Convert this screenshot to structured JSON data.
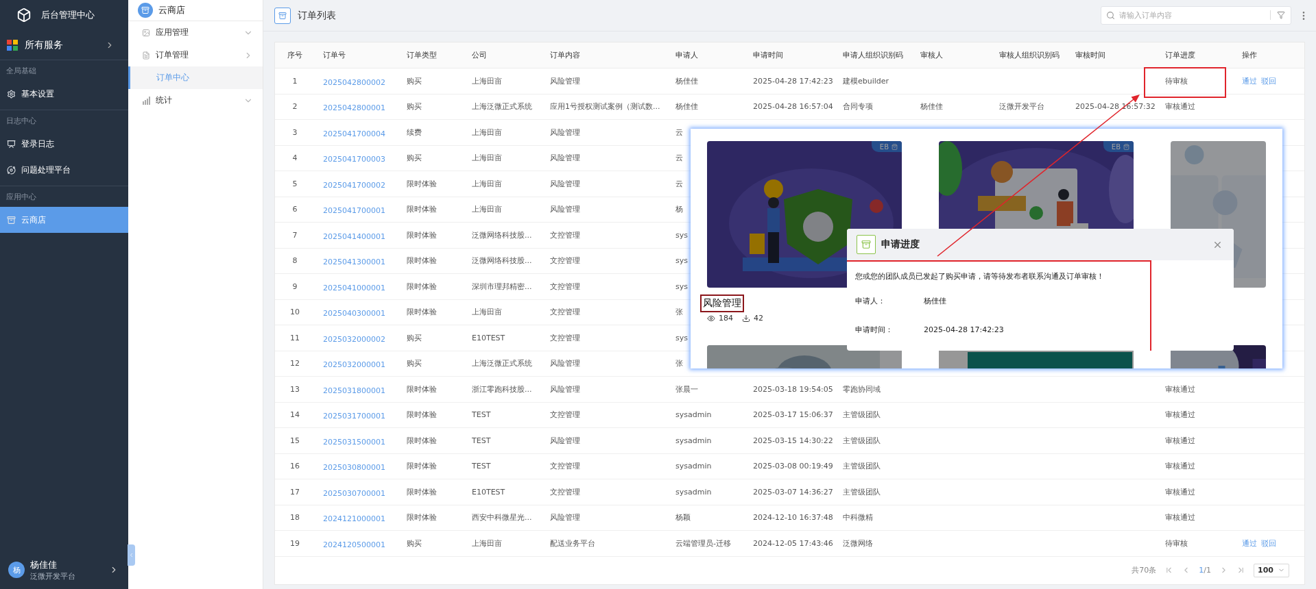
{
  "app": {
    "title": "后台管理中心",
    "all_services": "所有服务"
  },
  "sidebar": {
    "sections": [
      {
        "label": "全局基础",
        "items": [
          {
            "label": "基本设置",
            "selected": false
          }
        ]
      },
      {
        "label": "日志中心",
        "items": [
          {
            "label": "登录日志",
            "selected": false
          },
          {
            "label": "问题处理平台",
            "selected": false
          }
        ]
      },
      {
        "label": "应用中心",
        "items": [
          {
            "label": "云商店",
            "selected": true
          }
        ]
      }
    ],
    "user": {
      "avatar": "杨",
      "name": "杨佳佳",
      "org": "泛微开发平台"
    }
  },
  "subnav": {
    "title": "云商店",
    "items": [
      {
        "label": "应用管理",
        "expanded": false
      },
      {
        "label": "订单管理",
        "expanded": true,
        "children": [
          {
            "label": "订单中心",
            "selected": true
          }
        ]
      },
      {
        "label": "统计",
        "expanded": false
      }
    ]
  },
  "header": {
    "title": "订单列表",
    "search": {
      "placeholder": "请输入订单内容"
    }
  },
  "table": {
    "columns": [
      "序号",
      "订单号",
      "订单类型",
      "公司",
      "订单内容",
      "申请人",
      "申请时间",
      "申请人组织识别码",
      "审核人",
      "审核人组织识别码",
      "审核时间",
      "订单进度",
      "操作"
    ],
    "rows": [
      {
        "seq": "1",
        "order_no": "2025042800002",
        "type": "购买",
        "company": "上海田亩",
        "content": "风险管理",
        "applicant": "杨佳佳",
        "apply_time": "2025-04-28 17:42:23",
        "applicant_org": "建模ebuilder",
        "progress": "待审核",
        "actions": [
          "通过",
          "驳回"
        ],
        "marked": true
      },
      {
        "seq": "2",
        "order_no": "2025042800001",
        "type": "购买",
        "company": "上海泛微正式系统",
        "content": "应用1号授权测试案例（测试数...",
        "applicant": "杨佳佳",
        "apply_time": "2025-04-28 16:57:04",
        "applicant_org": "合同专项",
        "reviewer": "杨佳佳",
        "reviewer_org": "泛微开发平台",
        "review_time": "2025-04-28 16:57:32",
        "progress": "审核通过",
        "marked": false
      },
      {
        "seq": "3",
        "order_no": "2025041700004",
        "type": "续费",
        "company": "上海田亩",
        "content": "风险管理",
        "applicant": "云",
        "marked": false
      },
      {
        "seq": "4",
        "order_no": "2025041700003",
        "type": "购买",
        "company": "上海田亩",
        "content": "风险管理",
        "applicant": "云",
        "marked": false
      },
      {
        "seq": "5",
        "order_no": "2025041700002",
        "type": "限时体验",
        "company": "上海田亩",
        "content": "风险管理",
        "applicant": "云",
        "marked": false
      },
      {
        "seq": "6",
        "order_no": "2025041700001",
        "type": "限时体验",
        "company": "上海田亩",
        "content": "风险管理",
        "applicant": "杨",
        "marked": false
      },
      {
        "seq": "7",
        "order_no": "2025041400001",
        "type": "限时体验",
        "company": "泛微网络科技股...",
        "content": "文控管理",
        "applicant": "sys",
        "marked": false
      },
      {
        "seq": "8",
        "order_no": "2025041300001",
        "type": "限时体验",
        "company": "泛微网络科技股...",
        "content": "文控管理",
        "applicant": "sys",
        "marked": false
      },
      {
        "seq": "9",
        "order_no": "2025041000001",
        "type": "限时体验",
        "company": "深圳市理邦精密...",
        "content": "文控管理",
        "applicant": "sys",
        "marked": false
      },
      {
        "seq": "10",
        "order_no": "2025040300001",
        "type": "限时体验",
        "company": "上海田亩",
        "content": "文控管理",
        "applicant": "张",
        "marked": false
      },
      {
        "seq": "11",
        "order_no": "2025032000002",
        "type": "购买",
        "company": "E10TEST",
        "content": "文控管理",
        "applicant": "sys",
        "marked": false
      },
      {
        "seq": "12",
        "order_no": "2025032000001",
        "type": "购买",
        "company": "上海泛微正式系统",
        "content": "风险管理",
        "applicant": "张",
        "marked": false
      },
      {
        "seq": "13",
        "order_no": "2025031800001",
        "type": "限时体验",
        "company": "浙江零跑科技股...",
        "content": "风险管理",
        "applicant": "张晨一",
        "apply_time": "2025-03-18 19:54:05",
        "applicant_org": "零跑协同域",
        "progress": "审核通过",
        "marked": false
      },
      {
        "seq": "14",
        "order_no": "2025031700001",
        "type": "限时体验",
        "company": "TEST",
        "content": "文控管理",
        "applicant": "sysadmin",
        "apply_time": "2025-03-17 15:06:37",
        "applicant_org": "主管级团队",
        "progress": "审核通过",
        "marked": false
      },
      {
        "seq": "15",
        "order_no": "2025031500001",
        "type": "限时体验",
        "company": "TEST",
        "content": "风险管理",
        "applicant": "sysadmin",
        "apply_time": "2025-03-15 14:30:22",
        "applicant_org": "主管级团队",
        "progress": "审核通过",
        "marked": false
      },
      {
        "seq": "16",
        "order_no": "2025030800001",
        "type": "限时体验",
        "company": "TEST",
        "content": "文控管理",
        "applicant": "sysadmin",
        "apply_time": "2025-03-08 00:19:49",
        "applicant_org": "主管级团队",
        "progress": "审核通过",
        "marked": false
      },
      {
        "seq": "17",
        "order_no": "2025030700001",
        "type": "限时体验",
        "company": "E10TEST",
        "content": "文控管理",
        "applicant": "sysadmin",
        "apply_time": "2025-03-07 14:36:27",
        "applicant_org": "主管级团队",
        "progress": "审核通过",
        "marked": false
      },
      {
        "seq": "18",
        "order_no": "2024121000001",
        "type": "限时体验",
        "company": "西安中科微星光...",
        "content": "风险管理",
        "applicant": "杨颖",
        "apply_time": "2024-12-10 16:37:48",
        "applicant_org": "中科微精",
        "progress": "审核通过",
        "marked": false
      },
      {
        "seq": "19",
        "order_no": "2024120500001",
        "type": "购买",
        "company": "上海田亩",
        "content": "配送业务平台",
        "applicant": "云端管理员-迁移",
        "apply_time": "2024-12-05 17:43:46",
        "applicant_org": "泛微网络",
        "progress": "待审核",
        "actions": [
          "通过",
          "驳回"
        ],
        "marked": false
      }
    ],
    "pagination": {
      "total": "共70条",
      "current": "1",
      "pages": "/1",
      "page_size": "100"
    }
  },
  "overlay": {
    "arrow": true,
    "cards": [
      {
        "image": {
          "kind": "picture"
        },
        "badge": "EB",
        "title": "风险管理",
        "views": "184",
        "installs": "42",
        "marked": true
      },
      {
        "image": {
          "kind": "picture"
        },
        "badge": "EB"
      },
      {
        "image": {
          "kind": "picture"
        }
      },
      {
        "image": {
          "kind": "picture"
        }
      },
      {
        "image": {
          "kind": "picture"
        }
      },
      {
        "image": {
          "kind": "picture"
        }
      }
    ],
    "dialog": {
      "title": "申请进度",
      "message": "您或您的团队成员已发起了购买申请，请等待发布者联系沟通及订单审核！",
      "fields": [
        {
          "label": "申请人：",
          "value": "杨佳佳"
        },
        {
          "label": "申请时间：",
          "value": "2025-04-28 17:42:23"
        }
      ],
      "marked": true
    }
  }
}
